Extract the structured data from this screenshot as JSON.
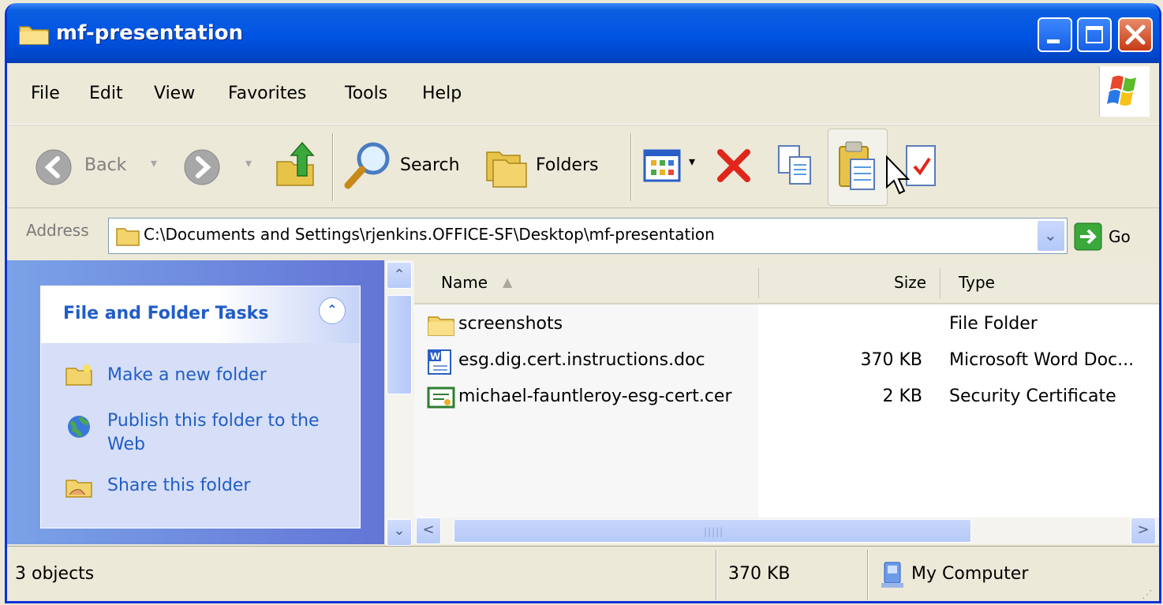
{
  "window": {
    "title": "mf-presentation",
    "title_icon": "folder-icon",
    "controls": [
      "minimize-icon",
      "maximize-icon",
      "close-icon"
    ]
  },
  "menu": [
    "File",
    "Edit",
    "View",
    "Favorites",
    "Tools",
    "Help"
  ],
  "toolbar": {
    "back_label": "Back",
    "search_label": "Search",
    "folders_label": "Folders"
  },
  "address": {
    "label": "Address",
    "value": "C:\\Documents and Settings\\rjenkins.OFFICE-SF\\Desktop\\mf-presentation",
    "go_label": "Go"
  },
  "taskpane": {
    "title": "File and Folder Tasks",
    "tasks": [
      "Make a new folder",
      "Publish this folder to the Web",
      "Share this folder"
    ]
  },
  "columns": {
    "name": "Name",
    "size": "Size",
    "type": "Type"
  },
  "files": [
    {
      "name": "screenshots",
      "size": "",
      "type": "File Folder",
      "icon": "folder-icon"
    },
    {
      "name": "esg.dig.cert.instructions.doc",
      "size": "370 KB",
      "type": "Microsoft Word Doc...",
      "icon": "word-doc-icon"
    },
    {
      "name": "michael-fauntleroy-esg-cert.cer",
      "size": "2 KB",
      "type": "Security Certificate",
      "icon": "certificate-icon"
    }
  ],
  "status": {
    "count": "3 objects",
    "size": "370 KB",
    "location": "My Computer"
  },
  "colors": {
    "titlebar": "#0054e3",
    "taskpane_link": "#215dc6",
    "close_button": "#c63b14"
  }
}
